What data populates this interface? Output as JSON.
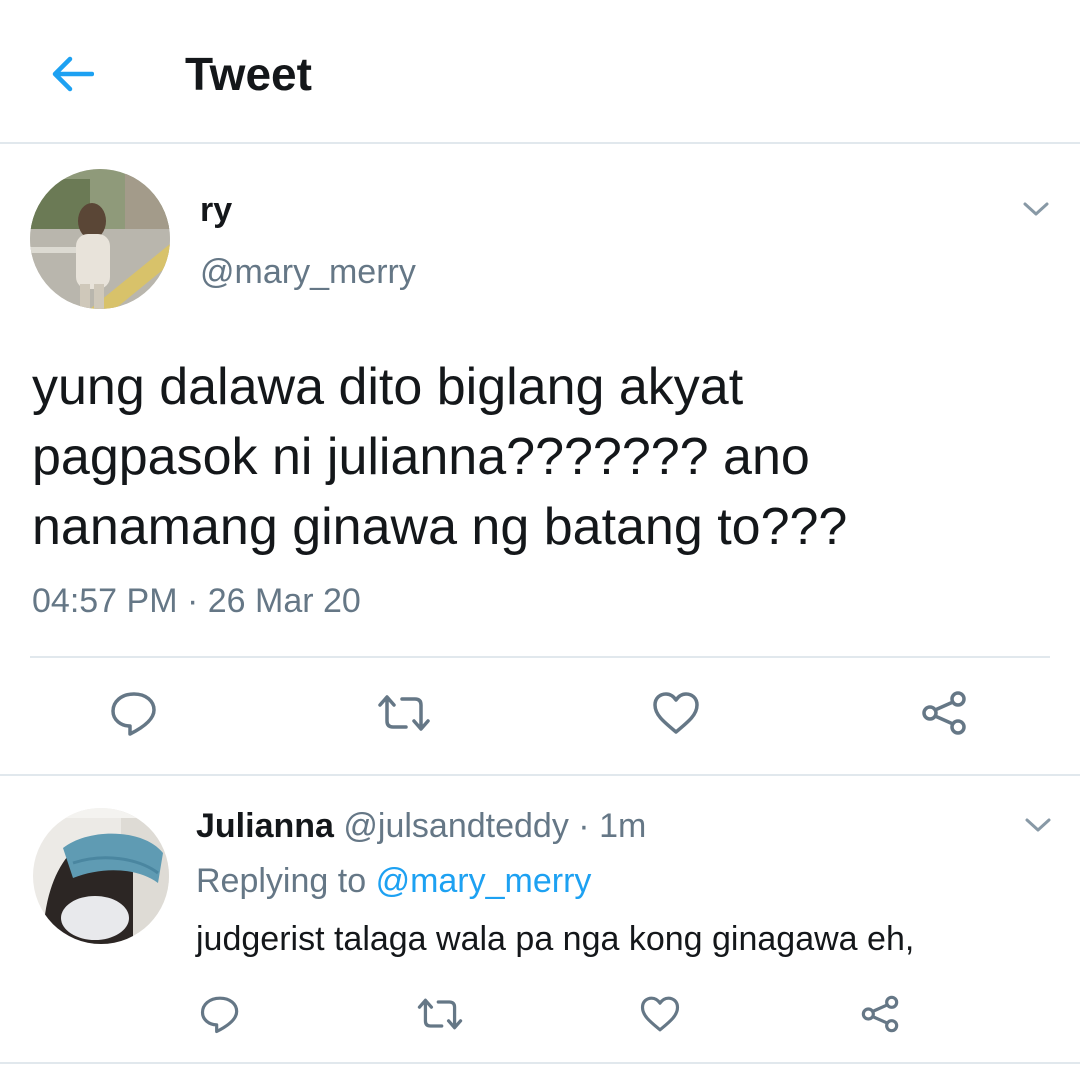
{
  "header": {
    "title": "Tweet",
    "back_icon": "arrow-left-icon",
    "accent": "#1da1f2"
  },
  "tweet": {
    "author_name": "ry",
    "author_handle": "@mary_merry",
    "text": "yung dalawa dito biglang akyat\npagpasok ni julianna??????? ano\nnanamang ginawa ng batang to???",
    "timestamp": "04:57 PM · 26 Mar 20",
    "actions": [
      "reply-icon",
      "retweet-icon",
      "like-icon",
      "share-icon"
    ]
  },
  "reply": {
    "author_name": "Julianna",
    "author_handle": "@julsandteddy",
    "separator": "·",
    "time": "1m",
    "replying_prefix": "Replying to",
    "replying_to": "@mary_merry",
    "text": "judgerist talaga wala pa nga kong ginagawa eh,",
    "actions": [
      "reply-icon",
      "retweet-icon",
      "like-icon",
      "share-icon"
    ]
  },
  "colors": {
    "text_primary": "#14171a",
    "text_secondary": "#657786",
    "link": "#1da1f2",
    "icon_gray": "#657786",
    "divider": "#e1e8ed"
  }
}
